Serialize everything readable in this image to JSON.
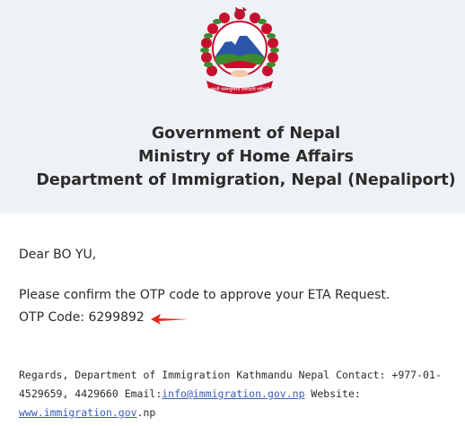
{
  "header": {
    "emblem_icon": "nepal-emblem-icon",
    "line1": "Government of Nepal",
    "line2": "Ministry of Home Affairs",
    "line3": "Department of Immigration, Nepal (Nepaliport)",
    "background": "#eef1f5"
  },
  "message": {
    "greeting": "Dear BO YU,",
    "confirm": "Please confirm the OTP code to approve your ETA Request.",
    "otp_label": "OTP Code: 6299892",
    "arrow_icon": "red-arrow-left-icon",
    "arrow_color": "#e8291c"
  },
  "footer": {
    "text1": "Regards, Department of Immigration Kathmandu Nepal Contact: +977-01-4529659, 4429660 Email:",
    "email": "info@immigration.gov.np",
    "text2": " Website: ",
    "website_link": "www.immigration.gov",
    "website_tail": ".np",
    "link_color": "#3a5bb5"
  }
}
